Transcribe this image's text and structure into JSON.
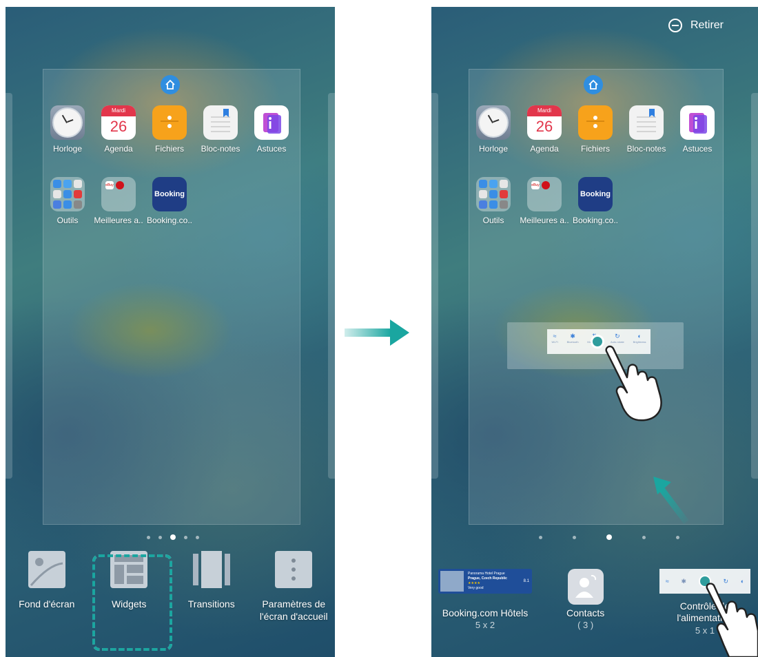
{
  "left_screen": {
    "apps_row1": [
      {
        "label": "Horloge"
      },
      {
        "label": "Agenda",
        "day": "Mardi",
        "date": "26"
      },
      {
        "label": "Fichiers"
      },
      {
        "label": "Bloc-notes"
      },
      {
        "label": "Astuces"
      }
    ],
    "apps_row2": [
      {
        "label": "Outils"
      },
      {
        "label": "Meilleures a..",
        "badge": "eBuy"
      },
      {
        "label": "Booking.co..",
        "icon_text": "Booking"
      }
    ],
    "page_indicator": {
      "count": 5,
      "active_index": 2
    },
    "menu": [
      {
        "label": "Fond d'écran"
      },
      {
        "label": "Widgets"
      },
      {
        "label": "Transitions"
      },
      {
        "label": "Paramètres de l'écran d'accueil"
      }
    ]
  },
  "right_screen": {
    "remove_label": "Retirer",
    "apps_row1": [
      {
        "label": "Horloge"
      },
      {
        "label": "Agenda",
        "day": "Mardi",
        "date": "26"
      },
      {
        "label": "Fichiers"
      },
      {
        "label": "Bloc-notes"
      },
      {
        "label": "Astuces"
      }
    ],
    "apps_row2": [
      {
        "label": "Outils"
      },
      {
        "label": "Meilleures a..",
        "badge": "eBuy"
      },
      {
        "label": "Booking.co..",
        "icon_text": "Booking"
      }
    ],
    "switch_labels": [
      "Wi-Fi",
      "Bluetooth",
      "Mobile data",
      "Auto-rotate",
      "Brightness"
    ],
    "page_indicator": {
      "count": 5,
      "active_index": 2
    },
    "widgets": [
      {
        "label": "Booking.com Hôtels",
        "size": "5 x 2",
        "thumb_title": "Panorama Hotel Prague",
        "thumb_sub": "Prague, Czech Republic",
        "thumb_rating": "Very good",
        "thumb_score": "8.1"
      },
      {
        "label": "Contacts",
        "size": "( 3 )"
      },
      {
        "label": "Contrôle de l'alimentation",
        "size": "5 x 1"
      }
    ]
  },
  "colors": {
    "accent_teal": "#1aa6a0",
    "home_blue": "#2f8ee0",
    "agenda_red": "#e2364b"
  }
}
